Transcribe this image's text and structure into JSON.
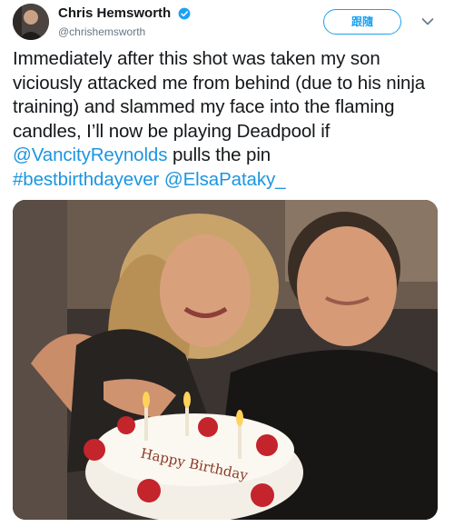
{
  "user": {
    "display_name": "Chris Hemsworth",
    "handle": "@chrishemsworth",
    "verified": true
  },
  "actions": {
    "follow_label": "跟隨",
    "more_icon": "chevron-down-icon"
  },
  "tweet": {
    "text_1": "Immediately after this shot was taken my son viciously attacked me from behind (due to his ninja training) and slammed my face into the flaming candles, I’ll now be playing Deadpool if ",
    "mention_1": "@VancityReynolds",
    "text_2": " pulls the pin",
    "hashtag_1": "#bestbirthdayever",
    "mention_2": "@ElsaPataky_"
  },
  "photo": {
    "cake_text": "Happy Birthday"
  },
  "colors": {
    "accent": "#1da1f2",
    "link": "#1b95e0",
    "muted": "#657786"
  }
}
